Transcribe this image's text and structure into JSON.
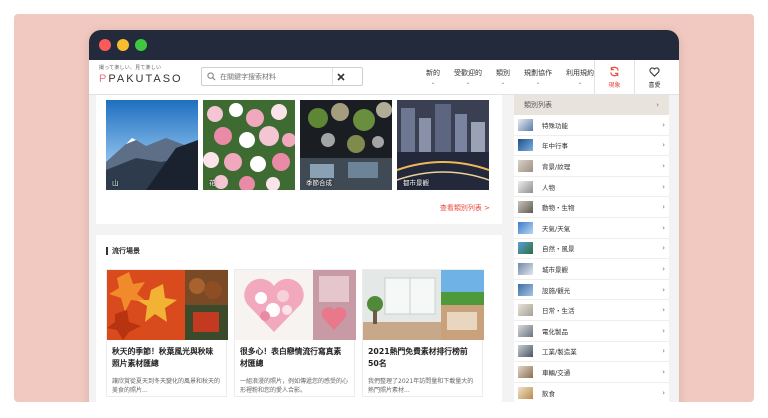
{
  "header": {
    "tagline": "撮って楽しい、見て楽しい",
    "logo": "PAKUTASO",
    "search_placeholder": "在關鍵字搜索材料",
    "nav": [
      {
        "label": "新的"
      },
      {
        "label": "受歡迎的"
      },
      {
        "label": "類別"
      },
      {
        "label": "規劃協作"
      },
      {
        "label": "利用規約"
      }
    ],
    "trend_label": "現象",
    "favorite_label": "喜愛"
  },
  "categories_card": {
    "tiles": [
      {
        "label": "山"
      },
      {
        "label": "花"
      },
      {
        "label": "季節合成"
      },
      {
        "label": "都市景觀"
      }
    ],
    "more_link": "查看類別列表 >"
  },
  "popular": {
    "title": "流行場景",
    "articles": [
      {
        "title": "秋天的季節！秋葉風光與秋味照片素材匯總",
        "desc": "讓欣賞從夏天到冬天變化的風景和秋天的美食的照片..."
      },
      {
        "title": "很多心！表白戀情流行寫真素材匯總",
        "desc": "一組浪漫的照片，例如傳遞您的感受的心形裡粉和您的愛人合影。"
      },
      {
        "title": "2021熱門免費素材排行榜前50名",
        "desc": "我們整理了2021年訪問量和下載量大的熱門照片素材..."
      }
    ]
  },
  "sidebar": {
    "header": "類別列表",
    "items": [
      {
        "label": "特殊功能"
      },
      {
        "label": "年中行事"
      },
      {
        "label": "背景/紋理"
      },
      {
        "label": "人物"
      },
      {
        "label": "動物・生物"
      },
      {
        "label": "天氣/天氣"
      },
      {
        "label": "自然・風景"
      },
      {
        "label": "城市景觀"
      },
      {
        "label": "設施/觀光"
      },
      {
        "label": "日常・生活"
      },
      {
        "label": "電化製品"
      },
      {
        "label": "工業/製造業"
      },
      {
        "label": "車輛/交通"
      },
      {
        "label": "飲食"
      }
    ]
  }
}
